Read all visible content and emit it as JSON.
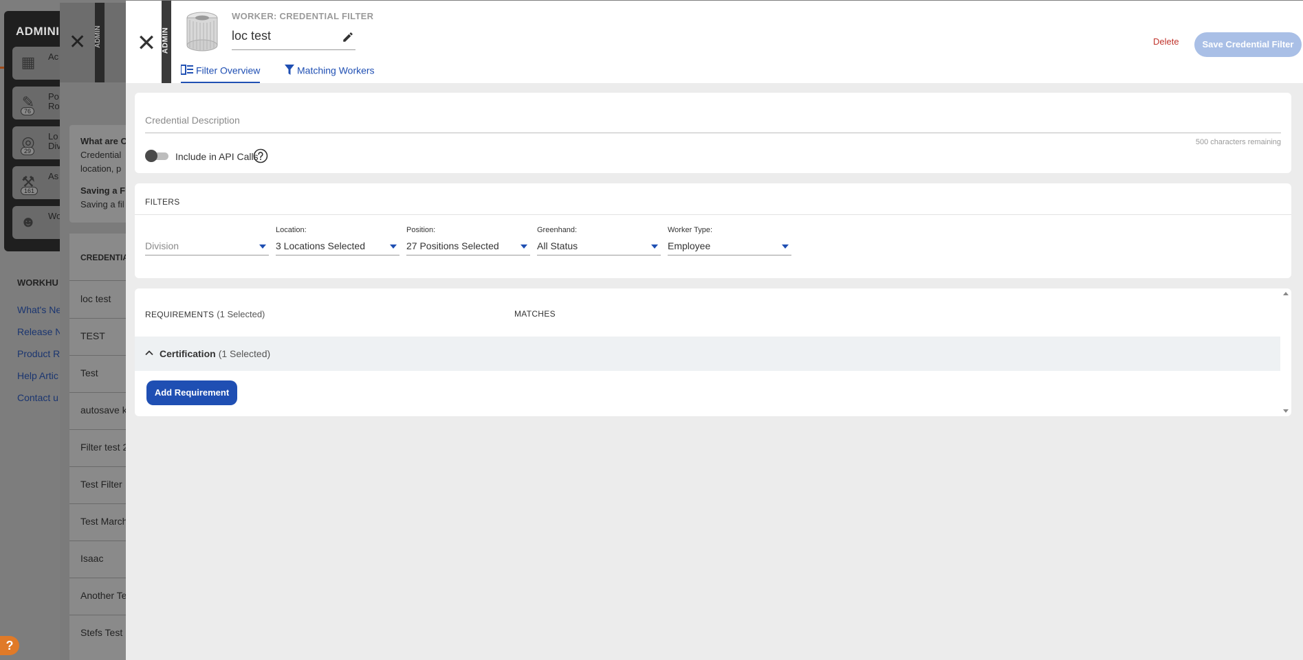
{
  "background": {
    "admin_title": "ADMINIS",
    "admin_items": [
      {
        "label": "Ac",
        "badge": ""
      },
      {
        "label": "Po\nRo",
        "badge": "76"
      },
      {
        "label": "Lo\nDiv",
        "badge": "29"
      },
      {
        "label": "As",
        "badge": "161"
      },
      {
        "label": "Wo",
        "badge": ""
      }
    ],
    "workhub_title": "WORKHU",
    "workhub_links": [
      "What's Ne",
      "Release N",
      "Product R",
      "Help Artic",
      "Contact u"
    ],
    "panel_admin_label": "ADMIN",
    "info_title_1": "What are C",
    "info_text_1": "Credential",
    "info_text_2": "location, p",
    "info_title_2": "Saving a F",
    "info_text_3": "Saving a fil",
    "list_header": "CREDENTIA",
    "list_items": [
      "loc test",
      "TEST",
      "Test",
      "autosave k",
      "Filter test 2",
      "Test Filter",
      "Test March",
      "Isaac",
      "Another Te",
      "Stefs Test"
    ],
    "help_button": "?"
  },
  "header": {
    "admin_label": "ADMIN",
    "eyebrow": "WORKER: CREDENTIAL FILTER",
    "title": "loc test",
    "delete_label": "Delete",
    "save_label": "Save Credential Filter"
  },
  "tabs": [
    {
      "label": "Filter Overview",
      "icon": "list-icon",
      "active": true
    },
    {
      "label": "Matching Workers",
      "icon": "filter-icon",
      "active": false
    }
  ],
  "description": {
    "placeholder": "Credential Description",
    "value": "",
    "remaining": "500 characters remaining",
    "toggle_label": "Include in API Calls",
    "toggle_on": false
  },
  "filters": {
    "title": "FILTERS",
    "fields": [
      {
        "label": "",
        "value": "Division",
        "placeholder": true
      },
      {
        "label": "Location:",
        "value": "3 Locations Selected",
        "placeholder": false
      },
      {
        "label": "Position:",
        "value": "27 Positions Selected",
        "placeholder": false
      },
      {
        "label": "Greenhand:",
        "value": "All Status",
        "placeholder": false
      },
      {
        "label": "Worker Type:",
        "value": "Employee",
        "placeholder": false
      }
    ]
  },
  "requirements": {
    "title": "REQUIREMENTS",
    "selected": "(1 Selected)",
    "matches_title": "MATCHES",
    "group_name": "Certification",
    "group_selected": "(1 Selected)",
    "add_label": "Add Requirement"
  },
  "colors": {
    "accent": "#1f4fb3",
    "delete": "#c0332b",
    "save_disabled": "#a9bfe6",
    "help_fab": "#e07a28"
  }
}
